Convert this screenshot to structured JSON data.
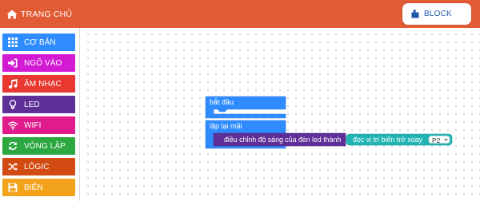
{
  "header": {
    "home_label": "TRANG CHỦ",
    "home_icon": "home-icon",
    "block_label": "BLOCK",
    "block_icon": "puzzle-icon",
    "bar_color": "#e15b34"
  },
  "categories": [
    {
      "label": "CƠ BẢN",
      "icon": "grid-icon",
      "color": "#2f8cff"
    },
    {
      "label": "NGÕ VÀO",
      "icon": "sign-in-icon",
      "color": "#d41bd4"
    },
    {
      "label": "ÂM NHẠC",
      "icon": "music-icon",
      "color": "#e8382f"
    },
    {
      "label": "LED",
      "icon": "lightbulb-icon",
      "color": "#5f2f98"
    },
    {
      "label": "WIFI",
      "icon": "wifi-icon",
      "color": "#e01c8c"
    },
    {
      "label": "VÒNG LẶP",
      "icon": "refresh-icon",
      "color": "#2ba83f"
    },
    {
      "label": "LÔGIC",
      "icon": "shuffle-icon",
      "color": "#d24b12"
    },
    {
      "label": "BIẾN",
      "icon": "save-icon",
      "color": "#f2a21b"
    }
  ],
  "blocks": {
    "start_label": "bắt đầu",
    "forever_label": "lặp lại mãi",
    "led_brightness_label": "điều chỉnh độ sáng của đèn led thành",
    "potentiometer_label": "đọc vị trí biến trở xoay",
    "pin_value": "P2"
  }
}
